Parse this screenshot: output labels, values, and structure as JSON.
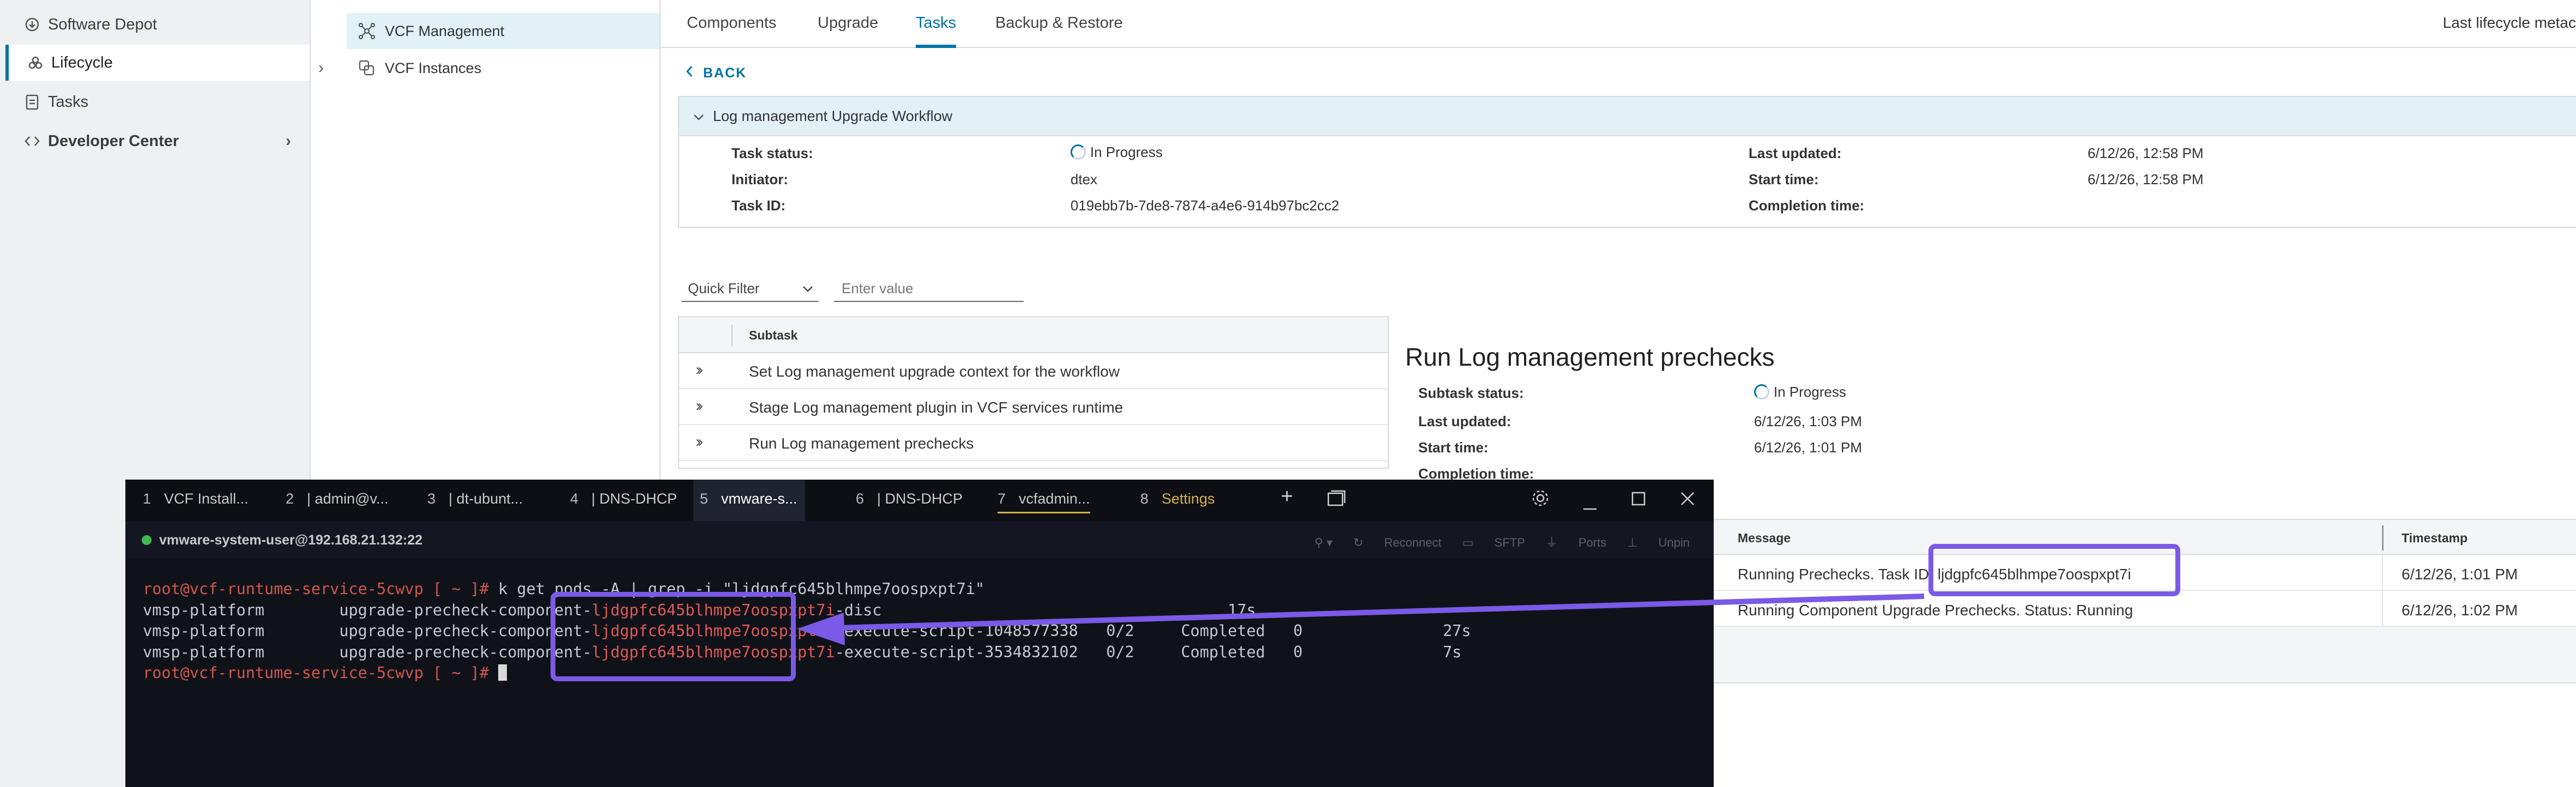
{
  "leftnav": {
    "items": [
      {
        "label": "Software Depot",
        "icon": "depot-icon"
      },
      {
        "label": "Lifecycle",
        "icon": "lifecycle-icon",
        "active": true
      },
      {
        "label": "Tasks",
        "icon": "tasks-icon"
      },
      {
        "label": "Developer Center",
        "icon": "code-icon",
        "chevron": "›"
      }
    ]
  },
  "tree": {
    "items": [
      {
        "label": "VCF Management",
        "selected": true
      },
      {
        "label": "VCF Instances",
        "expander": "›"
      }
    ]
  },
  "tabs": [
    "Components",
    "Upgrade",
    "Tasks",
    "Backup & Restore"
  ],
  "active_tab": "Tasks",
  "last_meta": "Last lifecycle metac",
  "back": "BACK",
  "workflow": {
    "title": "Log management Upgrade Workflow",
    "task_status_label": "Task status:",
    "task_status": "In Progress",
    "initiator_label": "Initiator:",
    "initiator": "dtex",
    "task_id_label": "Task ID:",
    "task_id": "019ebb7b-7de8-7874-a4e6-914b97bc2cc2",
    "last_updated_label": "Last updated:",
    "last_updated": "6/12/26, 12:58 PM",
    "start_time_label": "Start time:",
    "start_time": "6/12/26, 12:58 PM",
    "completion_time_label": "Completion time:",
    "completion_time": ""
  },
  "filter": {
    "quick_filter": "Quick Filter",
    "placeholder": "Enter value"
  },
  "subtasks": {
    "header": "Subtask",
    "rows": [
      "Set Log management upgrade context for the workflow",
      "Stage Log management plugin in VCF services runtime",
      "Run Log management prechecks"
    ]
  },
  "detail": {
    "title": "Run Log management prechecks",
    "status_label": "Subtask status:",
    "status": "In Progress",
    "last_updated_label": "Last updated:",
    "last_updated": "6/12/26, 1:03 PM",
    "start_time_label": "Start time:",
    "start_time": "6/12/26, 1:01 PM",
    "completion_time_label": "Completion time:",
    "completion_time": ""
  },
  "messages": {
    "headers": [
      "Message",
      "Timestamp"
    ],
    "rows": [
      {
        "message": "Running Prechecks. Task ID: ljdgpfc645blhmpe7oospxpt7i",
        "timestamp": "6/12/26, 1:01 PM"
      },
      {
        "message": "Running Component Upgrade Prechecks. Status: Running",
        "timestamp": "6/12/26, 1:02 PM"
      }
    ]
  },
  "terminal": {
    "tabs": [
      {
        "num": "1",
        "label": "VCF Install..."
      },
      {
        "num": "2",
        "label": "| admin@v..."
      },
      {
        "num": "3",
        "label": "| dt-ubunt..."
      },
      {
        "num": "4",
        "label": "| DNS-DHCP"
      },
      {
        "num": "5",
        "label": "vmware-s...",
        "active": true
      },
      {
        "num": "6",
        "label": "| DNS-DHCP"
      },
      {
        "num": "7",
        "label": "vcfadmin..."
      },
      {
        "num": "8",
        "label": "Settings"
      }
    ],
    "session": "vmware-system-user@192.168.21.132:22",
    "tools": [
      "Reconnect",
      "SFTP",
      "Ports",
      "Unpin"
    ],
    "prompt": "root@vcf-runtume-service-5cwvp [ ~ ]#",
    "command": " k get pods -A | grep -i \"ljdgpfc645blhmpe7oospxpt7i\"",
    "rows": [
      {
        "ns": "vmsp-platform",
        "prefix": "upgrade-precheck-component-",
        "id": "ljdgpfc645blhmpe7oospxpt7i",
        "suffix": "-disc",
        "ready": "",
        "status": "",
        "restarts": "",
        "age": "17s"
      },
      {
        "ns": "vmsp-platform",
        "prefix": "upgrade-precheck-component-",
        "id": "ljdgpfc645blhmpe7oospxpt7i",
        "suffix": "-execute-script-1048577338",
        "ready": "0/2",
        "status": "Completed",
        "restarts": "0",
        "age": "27s"
      },
      {
        "ns": "vmsp-platform",
        "prefix": "upgrade-precheck-component-",
        "id": "ljdgpfc645blhmpe7oospxpt7i",
        "suffix": "-execute-script-3534832102",
        "ready": "0/2",
        "status": "Completed",
        "restarts": "0",
        "age": "7s"
      }
    ]
  },
  "colors": {
    "accent": "#0072a3",
    "highlight": "#7a5ae6",
    "term_bg": "#10121a",
    "prompt_red": "#d0574a"
  }
}
